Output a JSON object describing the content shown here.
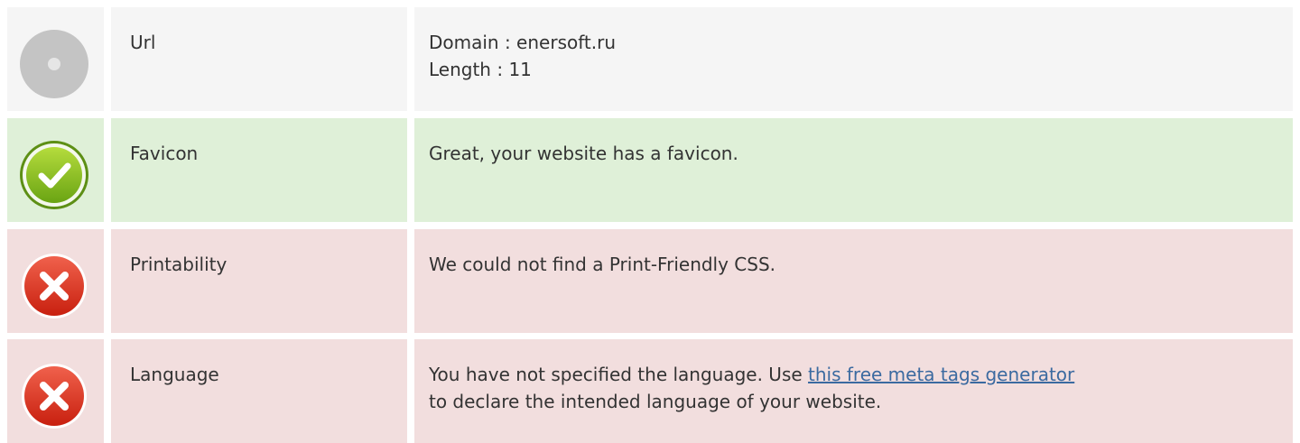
{
  "colors": {
    "neutral_bg": "#f5f5f5",
    "ok_bg": "#dff0d8",
    "bad_bg": "#f2dede",
    "link": "#3b6aa0"
  },
  "rows": [
    {
      "status": "neutral",
      "icon": "neutral-circle-icon",
      "label": "Url",
      "lines": [
        "Domain : enersoft.ru",
        "Length : 11"
      ]
    },
    {
      "status": "ok",
      "icon": "check-circle-icon",
      "label": "Favicon",
      "lines": [
        "Great, your website has a favicon."
      ]
    },
    {
      "status": "bad",
      "icon": "error-x-icon",
      "label": "Printability",
      "lines": [
        "We could not find a Print-Friendly CSS."
      ]
    },
    {
      "status": "bad",
      "icon": "error-x-icon",
      "label": "Language",
      "text_before_link": "You have not specified the language. Use ",
      "link_text": "this free meta tags generator",
      "text_after_link": "to declare the intended language of your website."
    }
  ]
}
